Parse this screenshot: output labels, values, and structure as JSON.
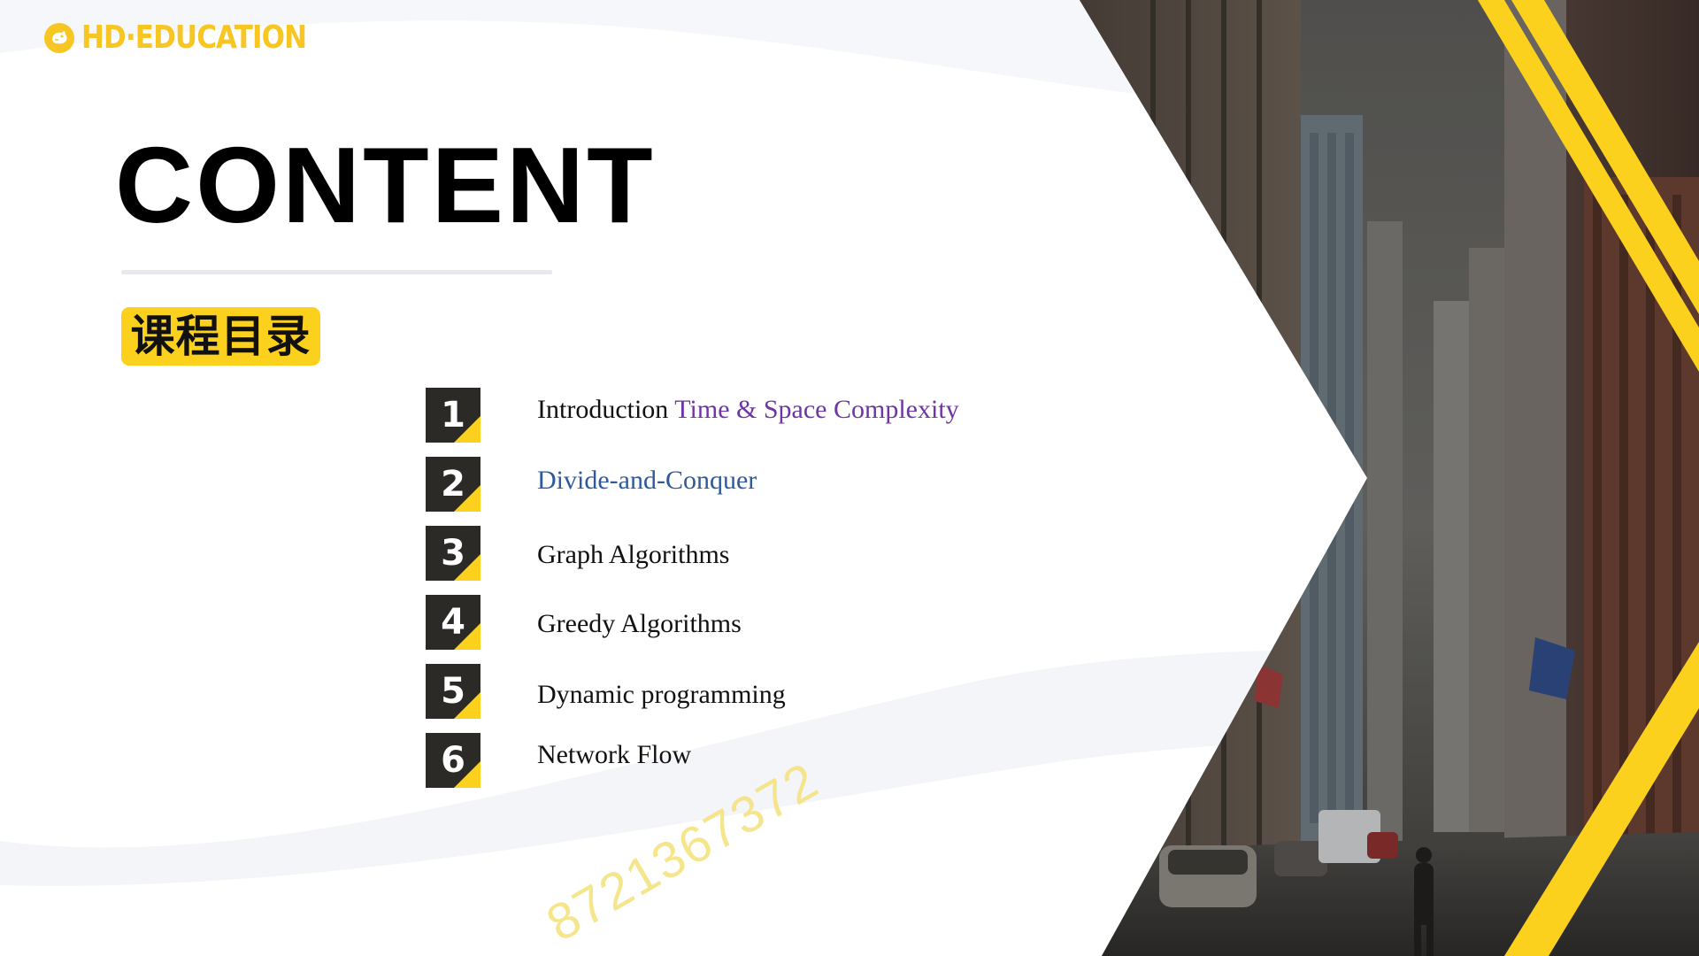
{
  "logo": {
    "text": "HD·EDUCATION",
    "icon": "dog-head-icon",
    "color": "#f7c623"
  },
  "title": "CONTENT",
  "subtitle_cn": "课程目录",
  "agenda": [
    {
      "number": "1",
      "label": "Introduction ",
      "label_accent": "Time & Space Complexity"
    },
    {
      "number": "2",
      "label": "Divide-and-Conquer"
    },
    {
      "number": "3",
      "label": "Graph Algorithms"
    },
    {
      "number": "4",
      "label": "Greedy Algorithms"
    },
    {
      "number": "5",
      "label": "Dynamic programming"
    },
    {
      "number": "6",
      "label": "Network Flow"
    }
  ],
  "watermark": "8721367372",
  "colors": {
    "accent_yellow": "#fbd11d",
    "badge_dark": "#2b2a27",
    "purple_text": "#6f35a5",
    "blue_text": "#2e5a9c"
  }
}
